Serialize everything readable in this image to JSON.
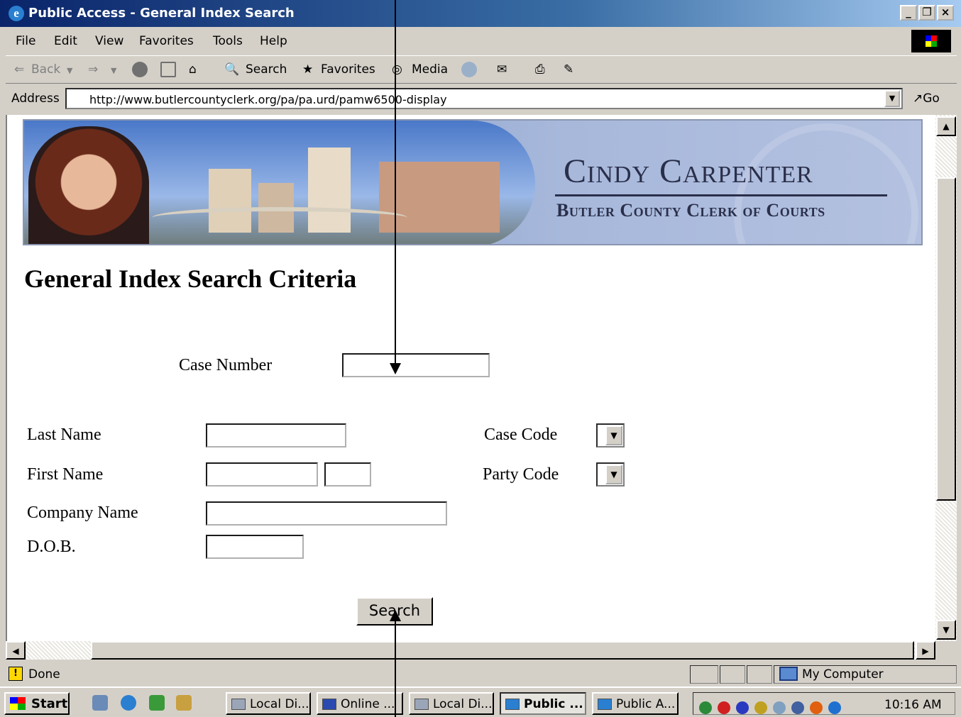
{
  "window": {
    "title": "Public Access - General Index Search",
    "controls": [
      "_",
      "❐",
      "×"
    ]
  },
  "menu": [
    "File",
    "Edit",
    "View",
    "Favorites",
    "Tools",
    "Help"
  ],
  "toolbar": {
    "back": "Back",
    "search": "Search",
    "favorites": "Favorites",
    "media": "Media"
  },
  "address": {
    "label": "Address",
    "url": "http://www.butlercountyclerk.org/pa/pa.urd/pamw6500-display",
    "go": "Go"
  },
  "banner": {
    "name": "Cindy Carpenter",
    "subtitle": "Butler County Clerk of Courts"
  },
  "page": {
    "heading": "General Index Search Criteria",
    "fields": {
      "case_number": "Case Number",
      "last_name": "Last Name",
      "first_name": "First Name",
      "company_name": "Company Name",
      "dob": "D.O.B.",
      "case_code": "Case Code",
      "party_code": "Party Code"
    },
    "search_button": "Search"
  },
  "status": {
    "text": "Done",
    "zone": "My Computer"
  },
  "taskbar": {
    "start": "Start",
    "tasks": [
      "Local Di...",
      "Online ...",
      "Local Di...",
      "Public ...",
      "Public A..."
    ],
    "active_task": 3,
    "clock": "10:16 AM"
  }
}
